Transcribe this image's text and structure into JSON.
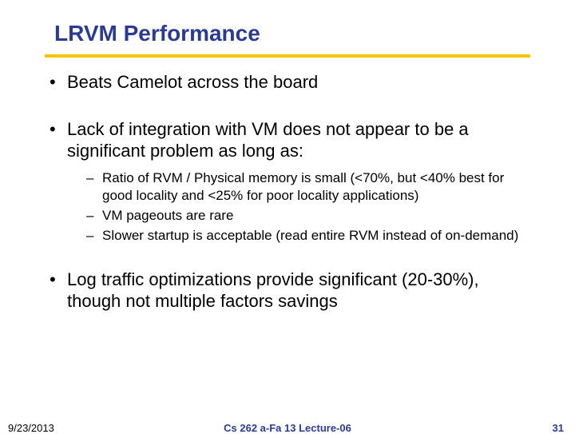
{
  "title": "LRVM Performance",
  "bullets": [
    {
      "text": "Beats Camelot across the board",
      "sub": []
    },
    {
      "text": "Lack of integration with VM does not appear to be a significant problem as long as:",
      "sub": [
        "Ratio of RVM / Physical memory is small (<70%, but <40% best for good locality and <25% for poor locality applications)",
        "VM pageouts are rare",
        "Slower startup is acceptable (read entire RVM instead of on-demand)"
      ]
    },
    {
      "text": "Log traffic optimizations provide significant (20-30%), though not multiple factors savings",
      "sub": []
    }
  ],
  "footer": {
    "date": "9/23/2013",
    "lecture": "Cs 262 a-Fa 13 Lecture-06",
    "pagenum": "31"
  }
}
